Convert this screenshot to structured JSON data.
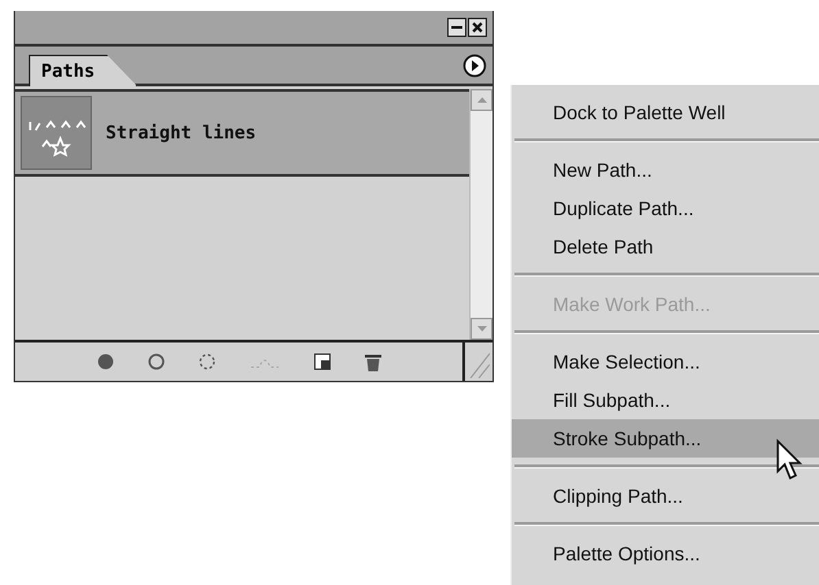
{
  "palette": {
    "tab": "Paths",
    "paths": [
      {
        "name": "Straight lines",
        "selected": true
      }
    ]
  },
  "menu": {
    "items": [
      {
        "kind": "item",
        "label": "Dock to Palette Well",
        "disabled": false,
        "selected": false
      },
      {
        "kind": "separator"
      },
      {
        "kind": "item",
        "label": "New Path...",
        "disabled": false,
        "selected": false
      },
      {
        "kind": "item",
        "label": "Duplicate Path...",
        "disabled": false,
        "selected": false
      },
      {
        "kind": "item",
        "label": "Delete Path",
        "disabled": false,
        "selected": false
      },
      {
        "kind": "separator"
      },
      {
        "kind": "item",
        "label": "Make Work Path...",
        "disabled": true,
        "selected": false
      },
      {
        "kind": "separator"
      },
      {
        "kind": "item",
        "label": "Make Selection...",
        "disabled": false,
        "selected": false
      },
      {
        "kind": "item",
        "label": "Fill Subpath...",
        "disabled": false,
        "selected": false
      },
      {
        "kind": "item",
        "label": "Stroke Subpath...",
        "disabled": false,
        "selected": true
      },
      {
        "kind": "separator"
      },
      {
        "kind": "item",
        "label": "Clipping Path...",
        "disabled": false,
        "selected": false
      },
      {
        "kind": "separator"
      },
      {
        "kind": "item",
        "label": "Palette Options...",
        "disabled": false,
        "selected": false
      }
    ]
  }
}
